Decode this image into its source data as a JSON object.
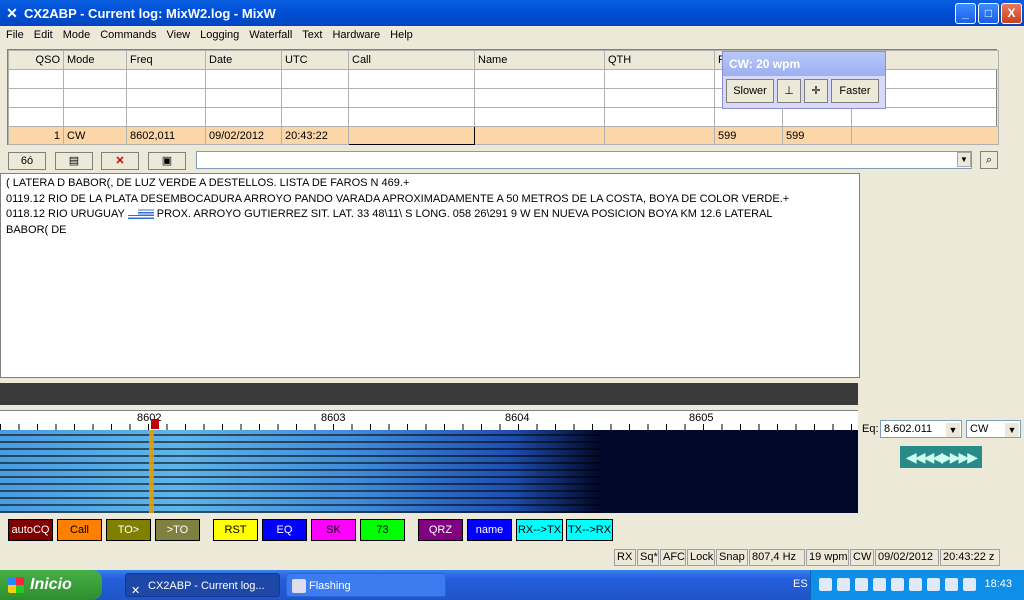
{
  "window": {
    "title": "CX2ABP - Current log: MixW2.log - MixW",
    "app_icon": "mixw-icon",
    "buttons": {
      "minimize": "_",
      "maximize": "□",
      "close": "X"
    }
  },
  "menu": [
    "File",
    "Edit",
    "Mode",
    "Commands",
    "View",
    "Logging",
    "Waterfall",
    "Text",
    "Hardware",
    "Help"
  ],
  "log": {
    "columns": [
      "QSO",
      "Mode",
      "Freq",
      "Date",
      "UTC",
      "Call",
      "Name",
      "QTH",
      "R",
      "",
      "e"
    ],
    "current_row": {
      "qso": "1",
      "mode": "CW",
      "freq": "8602,011",
      "date": "09/02/2012",
      "utc": "20:43:22",
      "call": "",
      "name": "",
      "qth": "",
      "rst_sent": "599",
      "rst_rcvd": "599",
      "extra": ""
    }
  },
  "cw_window": {
    "title": "CW: 20 wpm",
    "slower": "Slower",
    "faster": "Faster"
  },
  "toolbar": {
    "glasses": "6ó",
    "command_value": ""
  },
  "rx_text": {
    "line1": "( LATERA D BABOR(, DE LUZ VERDE A DESTELLOS. LISTA DE FAROS N 469.+",
    "line2": "0119.12 RIO DE LA PLATA DESEMBOCADURA ARROYO PANDO VARADA APROXIMADAMENTE A 50 METROS DE LA COSTA, BOYA DE COLOR VERDE.+",
    "line3a": "0118.12 RIO URUGUAY",
    "line3b": "PROX. ARROYO GUTIERREZ SIT. LAT. 33 48\\11\\ S LONG. 058 26\\291 9 W EN NUEVA POSICION BOYA KM 12.6 LATERAL",
    "line4": "BABOR( DE"
  },
  "waterfall": {
    "scale_labels": [
      "8602",
      "8603",
      "8604",
      "8605"
    ]
  },
  "macros": [
    {
      "label": "autoCQ",
      "color": "#800000",
      "text": "#ffffff"
    },
    {
      "label": "Call",
      "color": "#ff8000",
      "text": "#000000"
    },
    {
      "label": "TO>",
      "color": "#808000",
      "text": "#ffffff"
    },
    {
      "label": ">TO",
      "color": "#808040",
      "text": "#ffffff"
    },
    {
      "label": "RST",
      "color": "#ffff00",
      "text": "#000000"
    },
    {
      "label": "EQ",
      "color": "#0000ff",
      "text": "#ffffff"
    },
    {
      "label": "SK",
      "color": "#ff00ff",
      "text": "#000000"
    },
    {
      "label": "73",
      "color": "#00ff00",
      "text": "#000000"
    },
    {
      "label": "QRZ",
      "color": "#800080",
      "text": "#ffffff"
    },
    {
      "label": "name",
      "color": "#0000ff",
      "text": "#ffffff"
    },
    {
      "label": "RX-->TX",
      "color": "#00ffff",
      "text": "#000000"
    },
    {
      "label": "TX-->RX",
      "color": "#00ffff",
      "text": "#000000"
    }
  ],
  "right_panel": {
    "eq_label": "Eq:",
    "freq_value": "8.602.011",
    "mode_value": "CW",
    "tuner": "◀◀◀◀▶▶▶▶"
  },
  "status": [
    "RX",
    "Sq*",
    "AFC",
    "Lock",
    "Snap",
    "807,4 Hz",
    "19 wpm",
    "CW",
    "09/02/2012",
    "20:43:22 z"
  ],
  "taskbar": {
    "start": "Inicio",
    "tasks": [
      "CX2ABP - Current log...",
      "Flashing"
    ],
    "lang": "ES",
    "time": "18:43"
  }
}
